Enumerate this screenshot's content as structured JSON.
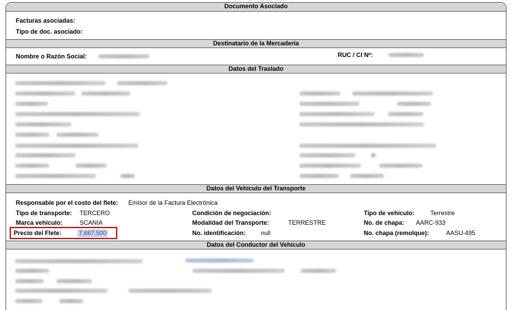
{
  "sections": {
    "documento_asociado": "Documento Asociado",
    "destinatario": "Destinatario de la Mercadería",
    "datos_traslado": "Datos del Traslado",
    "datos_vehiculo": "Datos del Vehículo del Transporte",
    "datos_conductor": "Datos del Conductor del Vehículo"
  },
  "documento": {
    "facturas_label": "Facturas asociadas:",
    "tipo_doc_label": "Tipo de doc. asociado:"
  },
  "destinatario": {
    "nombre_label": "Nombre o Razón Social:",
    "ruc_label": "RUC / CI Nº:"
  },
  "vehiculo": {
    "responsable_label": "Responsable por el costo del flete:",
    "responsable_value": "Emisor de la Factura Electrónica",
    "tipo_transporte_label": "Tipo de transporte:",
    "tipo_transporte_value": "TERCERO",
    "condicion_label": "Condición de negociación:",
    "tipo_vehiculo_label": "Tipo de vehículo:",
    "tipo_vehiculo_value": "Terrestre",
    "marca_label": "Marca vehículo:",
    "marca_value": "SCANIA",
    "modalidad_label": "Modalidad del Transporte:",
    "modalidad_value": "TERRESTRE",
    "chapa_label": "No. de chapa:",
    "chapa_value": "AARC-933",
    "precio_label": "Precio del Flete:",
    "precio_value": "7.667.500",
    "identificacion_label": "No. identificación:",
    "identificacion_value": "null",
    "chapa_remolque_label": "No. chapa (remolque):",
    "chapa_remolque_value": "AASU-495"
  }
}
